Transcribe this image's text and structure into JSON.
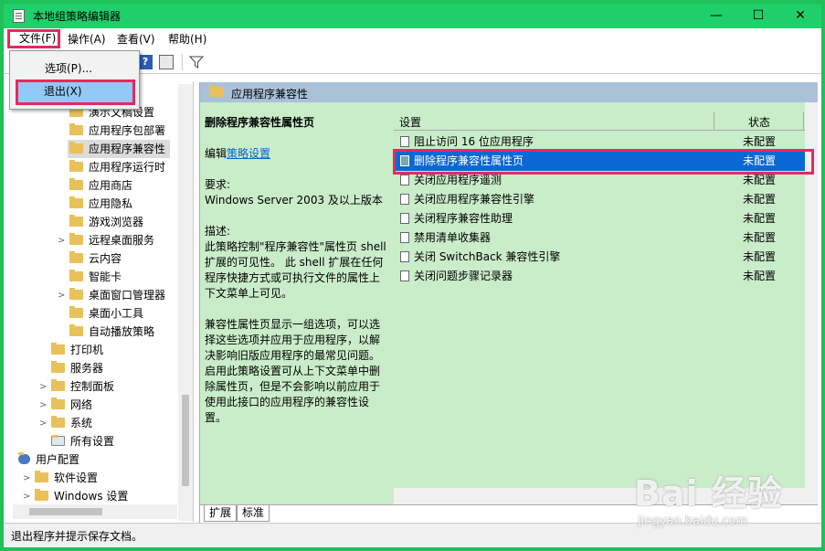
{
  "window": {
    "title": "本地组策略编辑器",
    "minimize": "—",
    "maximize": "☐",
    "close": "✕"
  },
  "menu": {
    "file": "文件(F)",
    "action": "操作(A)",
    "view": "查看(V)",
    "help": "帮助(H)"
  },
  "dropdown": {
    "options": "选项(P)...",
    "exit": "退出(X)"
  },
  "tree": {
    "items": [
      {
        "label": "演示文稿设置"
      },
      {
        "label": "应用程序包部署"
      },
      {
        "label": "应用程序兼容性"
      },
      {
        "label": "应用程序运行时"
      },
      {
        "label": "应用商店"
      },
      {
        "label": "应用隐私"
      },
      {
        "label": "游戏浏览器"
      },
      {
        "label": "远程桌面服务"
      },
      {
        "label": "云内容"
      },
      {
        "label": "智能卡"
      },
      {
        "label": "桌面窗口管理器"
      },
      {
        "label": "桌面小工具"
      },
      {
        "label": "自动播放策略"
      },
      {
        "label": "打印机"
      },
      {
        "label": "服务器"
      },
      {
        "label": "控制面板"
      },
      {
        "label": "网络"
      },
      {
        "label": "系统"
      },
      {
        "label": "所有设置"
      },
      {
        "label": "用户配置"
      },
      {
        "label": "软件设置"
      },
      {
        "label": "Windows 设置"
      }
    ]
  },
  "pane": {
    "header": "应用程序兼容性",
    "desc_title": "删除程序兼容性属性页",
    "edit_prefix": "编辑",
    "edit_link": "策略设置",
    "req_label": "要求:",
    "req_value": "Windows Server 2003 及以上版本",
    "desc_label": "描述:",
    "desc_p1": "此策略控制\"程序兼容性\"属性页 shell 扩展的可见性。 此 shell 扩展在任何程序快捷方式或可执行文件的属性上下文菜单上可见。",
    "desc_p2": "兼容性属性页显示一组选项，可以选择这些选项并应用于应用程序，以解决影响旧版应用程序的最常见问题。启用此策略设置可从上下文菜单中删除属性页，但是不会影响以前应用于使用此接口的应用程序的兼容性设置。"
  },
  "list": {
    "col_setting": "设置",
    "col_state": "状态",
    "rows": [
      {
        "label": "阻止访问 16 位应用程序",
        "state": "未配置"
      },
      {
        "label": "删除程序兼容性属性页",
        "state": "未配置"
      },
      {
        "label": "关闭应用程序遥测",
        "state": "未配置"
      },
      {
        "label": "关闭应用程序兼容性引擎",
        "state": "未配置"
      },
      {
        "label": "关闭程序兼容性助理",
        "state": "未配置"
      },
      {
        "label": "禁用清单收集器",
        "state": "未配置"
      },
      {
        "label": "关闭 SwitchBack 兼容性引擎",
        "state": "未配置"
      },
      {
        "label": "关闭问题步骤记录器",
        "state": "未配置"
      }
    ]
  },
  "tabs": {
    "extended": "扩展",
    "standard": "标准"
  },
  "status": "退出程序并提示保存文档。",
  "watermark": {
    "big": "Bai 经验",
    "small": "jingyan.baidu.com"
  }
}
